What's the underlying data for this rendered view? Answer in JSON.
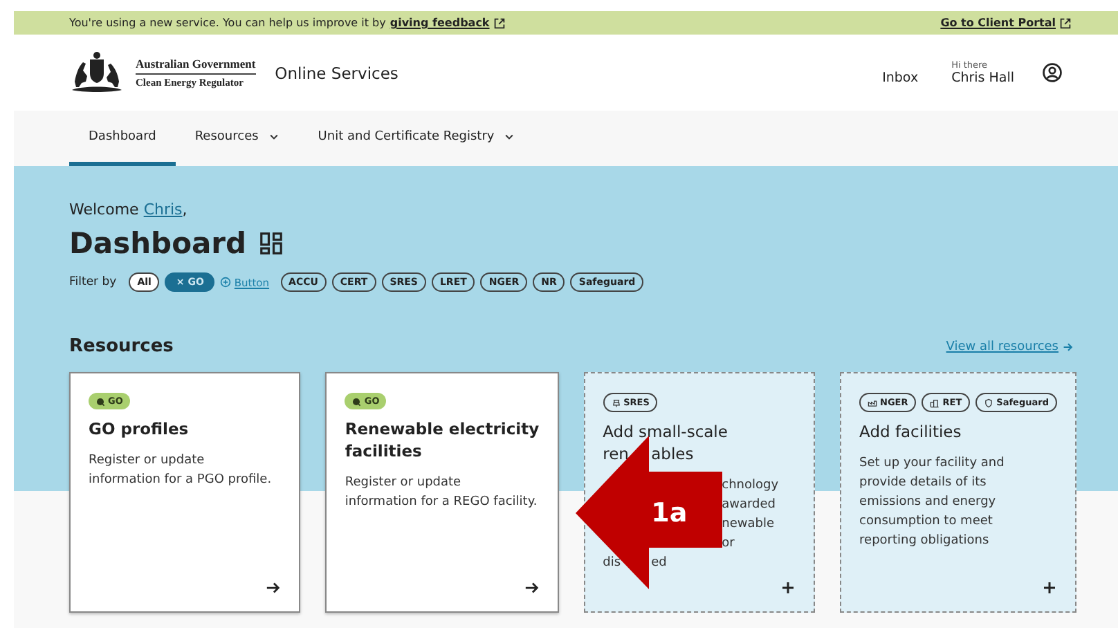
{
  "banner": {
    "message": "You're using a new service. You can help us improve it by",
    "feedback_link": "giving feedback",
    "portal_link": "Go to Client Portal"
  },
  "header": {
    "agency": "Australian Government",
    "agency_sub": "Clean Energy Regulator",
    "site_name": "Online Services",
    "inbox": "Inbox",
    "greeting": "Hi there",
    "user_name": "Chris Hall"
  },
  "nav": [
    {
      "label": "Dashboard",
      "selected": true,
      "dropdown": false
    },
    {
      "label": "Resources",
      "selected": false,
      "dropdown": true
    },
    {
      "label": "Unit and Certificate Registry",
      "selected": false,
      "dropdown": true
    }
  ],
  "welcome": {
    "prefix": "Welcome",
    "name": "Chris",
    "suffix": ","
  },
  "title": "Dashboard",
  "filter": {
    "label": "Filter by",
    "chips": [
      {
        "label": "All",
        "kind": "plain"
      },
      {
        "label": "× GO",
        "kind": "active"
      },
      {
        "label": "Button",
        "kind": "link"
      },
      {
        "label": "ACCU",
        "kind": "outline"
      },
      {
        "label": "CERT",
        "kind": "outline"
      },
      {
        "label": "SRES",
        "kind": "outline"
      },
      {
        "label": "LRET",
        "kind": "outline"
      },
      {
        "label": "NGER",
        "kind": "outline"
      },
      {
        "label": "NR",
        "kind": "outline"
      },
      {
        "label": "Safeguard",
        "kind": "outline"
      }
    ]
  },
  "resources": {
    "heading": "Resources",
    "view_all": "View all resources",
    "cards": [
      {
        "kind": "existing",
        "tags": [
          {
            "label": "GO",
            "kind": "go"
          }
        ],
        "title_lines": [
          [
            {
              "text": "GO profiles",
              "kind": "lead"
            }
          ]
        ],
        "description_lines": [
          [
            {
              "text": " Register or update",
              "kind": "lead"
            }
          ],
          [
            {
              "text": "information for a PGO profile.",
              "kind": "lead"
            }
          ]
        ]
      },
      {
        "kind": "existing",
        "tags": [
          {
            "label": "GO",
            "kind": "go"
          }
        ],
        "title_lines": [
          [
            {
              "text": "Renewable electricity",
              "kind": "lead"
            }
          ],
          [
            {
              "text": "facilities",
              "kind": "lead"
            }
          ]
        ],
        "description_lines": [
          [
            {
              "text": "Register or update",
              "kind": "lead"
            }
          ],
          [
            {
              "text": "information for a REGO facility.",
              "kind": "lead"
            }
          ]
        ]
      },
      {
        "kind": "add",
        "tags": [
          {
            "label": "SRES",
            "kind": "sres"
          }
        ],
        "title_lines": [
          [
            {
              "text": "Add small-scale",
              "kind": "lead"
            }
          ],
          [
            {
              "text": "ren",
              "kind": "lead"
            },
            {
              "text": "ables",
              "kind": "after-head"
            }
          ]
        ],
        "description_lines": [
          [
            {
              "text": "chnology",
              "kind": "after-shaft"
            }
          ],
          [
            {
              "text": "awarded",
              "kind": "after-shaft"
            }
          ],
          [
            {
              "text": "newable",
              "kind": "after-shaft"
            }
          ],
          [
            {
              "text": "or",
              "kind": "after-shaft"
            }
          ],
          [
            {
              "text": "dis",
              "kind": "lead"
            },
            {
              "text": "ed",
              "kind": "after-head"
            }
          ]
        ]
      },
      {
        "kind": "add",
        "tags": [
          {
            "label": "NGER",
            "kind": "nger"
          },
          {
            "label": "RET",
            "kind": "ret"
          },
          {
            "label": "Safeguard",
            "kind": "safeguard"
          }
        ],
        "title_lines": [
          [
            {
              "text": "Add facilities",
              "kind": "lead"
            }
          ]
        ],
        "description_lines": [
          [
            {
              "text": "Set up your facility and",
              "kind": "lead"
            }
          ],
          [
            {
              "text": "provide details of its",
              "kind": "lead"
            }
          ],
          [
            {
              "text": "emissions and energy",
              "kind": "lead"
            }
          ],
          [
            {
              "text": "consumption to meet",
              "kind": "lead"
            }
          ],
          [
            {
              "text": "reporting obligations",
              "kind": "lead"
            }
          ]
        ]
      }
    ]
  },
  "callout": {
    "label": "1a"
  }
}
